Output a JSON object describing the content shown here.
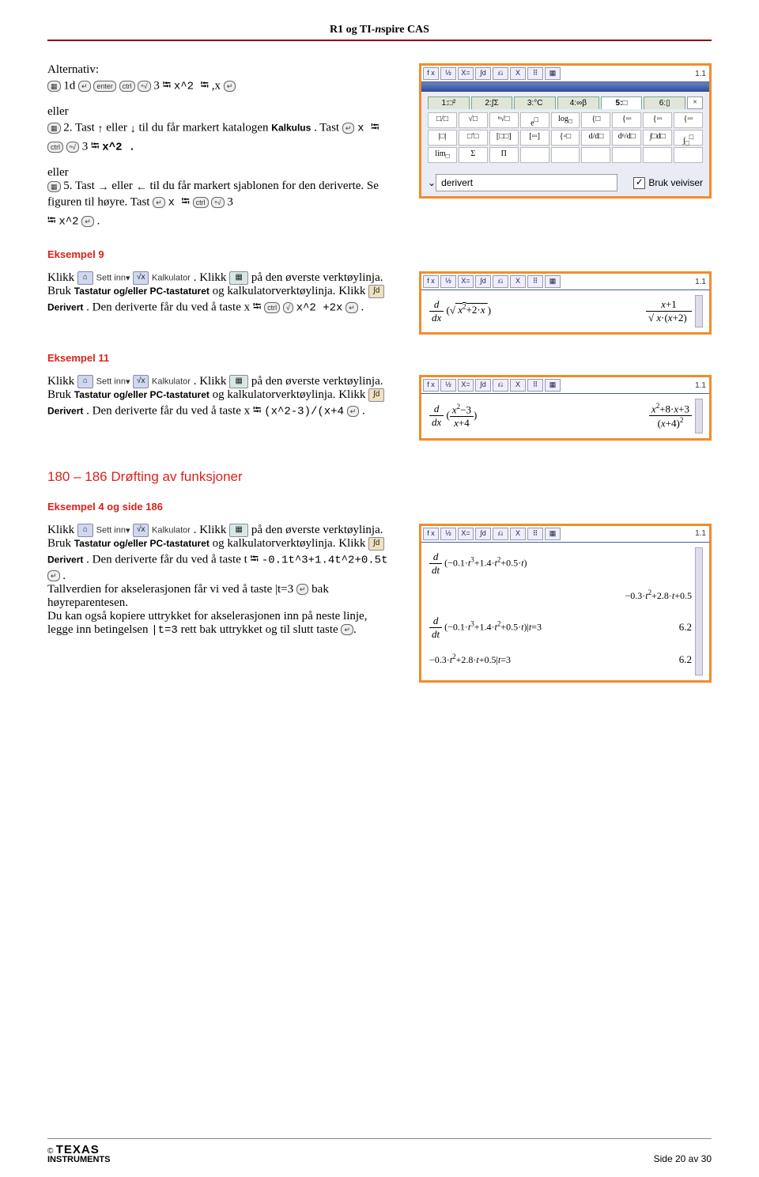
{
  "doc_title_prefix": "R1 og TI-",
  "doc_title_ital": "n",
  "doc_title_suffix": "spire CAS",
  "alt_label": "Alternativ:",
  "alt1_part1": " 1d ",
  "alt1_part2": " 3 ",
  "alt1_expr": " x^2 ",
  "alt1_part3": " ,x ",
  "eller": "eller",
  "alt2a": " 2. Tast ",
  "alt2b": " eller ",
  "alt2c": " til du får markert katalogen",
  "alt2_kalk": "Kalkulus",
  "alt2d": ". Tast ",
  "alt2e": "x ",
  "alt2f": " 3 ",
  "alt2g": " x^2 .",
  "alt3a": " 5. Tast ",
  "alt3b": " eller ",
  "alt3c": " til du får markert sjablonen for den deriverte. Se figuren til høyre. Tast ",
  "alt3d": "x ",
  "alt3e": " 3",
  "alt3f": " x^2",
  "alt3g": ".",
  "ex9": "Eksempel 9",
  "ex9_t1": "Klikk ",
  "ex9_settinn": "Sett inn",
  "ex9_kalk": "Kalkulator",
  "ex9_t2": ". Klikk ",
  "ex9_t3": " på den øverste verk­tøylinja. Bruk ",
  "ex9_t4": "Tastatur og/eller PC-tastaturet",
  "ex9_t5": " og kalkulatorverktøylinja. Klikk ",
  "ex9_deriv": "Derivert",
  "ex9_t6": ". Den deriverte får du ved å taste x ",
  "ex9_t7": " x^2 +2x",
  "ex9_t8": ".",
  "ex11": "Eksempel 11",
  "ex11_t6": ". Den deriverte får du ved å taste x ",
  "ex11_t7": " (x^2-3)/(x+4",
  "sect": "180 – 186  Drøfting av funksjoner",
  "ex4": "Eksempel 4 og side 186",
  "ex4_t6": ". Den deriverte får du ved å taste  t ",
  "ex4_t7": " -0.1t^3+1.4t^2+0.5t",
  "ex4_t8": ".",
  "ex4_para2": "Tallverdien for akselerasjonen får vi ved å taste |t=3",
  "ex4_para2b": " bak høyreparentesen.",
  "ex4_para3a": "Du kan også kopiere uttrykket for akselerasjonen inn på neste linje, legge inn betingelsen ",
  "ex4_para3b": "|t=3",
  "ex4_para3c": " rett bak uttrykket og til slutt taste ",
  "shot1_page": "1.1",
  "shot1_tabs": [
    "1:□²",
    "2:∫Σ",
    "3:°C",
    "4:∞β",
    "5:□",
    "6:▯"
  ],
  "shot1_dd_label": "derivert",
  "shot1_chk_label": "Bruk veiviser",
  "shot2_page": "1.1",
  "shot2_line_left": "d/dx (√(x²+2·x))",
  "shot2_line_right": "(x+1)/√(x·(x+2))",
  "shot3_page": "1.1",
  "shot3_line_left": "d/dx ((x²−3)/(x+4))",
  "shot3_line_right": "(x²+8·x+3)/(x+4)²",
  "shot4_page": "1.1",
  "shot4_l1_left": "d/dt (−0.1·t³+1.4·t²+0.5·t)",
  "shot4_l1_right": "−0.3·t²+2.8·t+0.5",
  "shot4_l2_left": "d/dt (−0.1·t³+1.4·t²+0.5·t)|t=3",
  "shot4_l2_right": "6.2",
  "shot4_l3_left": "−0.3·t²+2.8·t+0.5|t=3",
  "shot4_l3_right": "6.2",
  "footer_pg": "Side 20 av 30",
  "footer_brand_c": "©",
  "footer_brand_t": "TEXAS",
  "footer_brand_i": "INSTRUMENTS"
}
